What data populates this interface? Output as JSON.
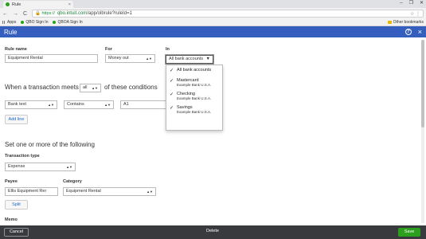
{
  "browser": {
    "tab_title": "Rule",
    "tab_close": "×",
    "window_controls": [
      "–",
      "❐",
      "✕"
    ],
    "nav": [
      "←",
      "→",
      "C"
    ],
    "lock_text": "🔒 https://",
    "url_host": "qbo.intuit.com",
    "url_path": "/app/olbrule?ruleId=1",
    "omni_right": "☆  ⋮",
    "bookmarks": [
      "Apps",
      "QBO Sign In",
      "QBOA Sign In"
    ],
    "other_bookmarks": "Other bookmarks"
  },
  "header": {
    "title": "Rule",
    "help": "?",
    "close": "×"
  },
  "form": {
    "rule_name_label": "Rule name",
    "rule_name_value": "Equipment Rental",
    "for_label": "For",
    "for_value": "Money out",
    "in_label": "In",
    "in_value": "All bank accounts",
    "conditions_prefix": "When a transaction meets",
    "conditions_match": "all",
    "conditions_suffix": "of these conditions",
    "cond_field": "Bank text",
    "cond_operator": "Contains",
    "cond_value": "A1",
    "add_line": "Add line",
    "section2": "Set one or more of the following",
    "txn_type_label": "Transaction type",
    "txn_type_value": "Expense",
    "payee_label": "Payee",
    "payee_value": "Ellis Equipment Rer",
    "category_label": "Category",
    "category_value": "Equipment Rental",
    "split": "Split",
    "memo_label": "Memo"
  },
  "dropdown": {
    "items": [
      {
        "check": "✓",
        "name": "All bank accounts",
        "sub": ""
      },
      {
        "check": "✓",
        "name": "Mastercard",
        "sub": "Example Bank U.S.A."
      },
      {
        "check": "✓",
        "name": "Checking",
        "sub": "Example Bank U.S.A."
      },
      {
        "check": "✓",
        "name": "Savings",
        "sub": "Example Bank U.S.A."
      }
    ]
  },
  "footer": {
    "cancel": "Cancel",
    "delete": "Delete",
    "save": "Save"
  },
  "colors": {
    "header": "#365ebf",
    "footer": "#393a3d",
    "save": "#2ca01c"
  }
}
